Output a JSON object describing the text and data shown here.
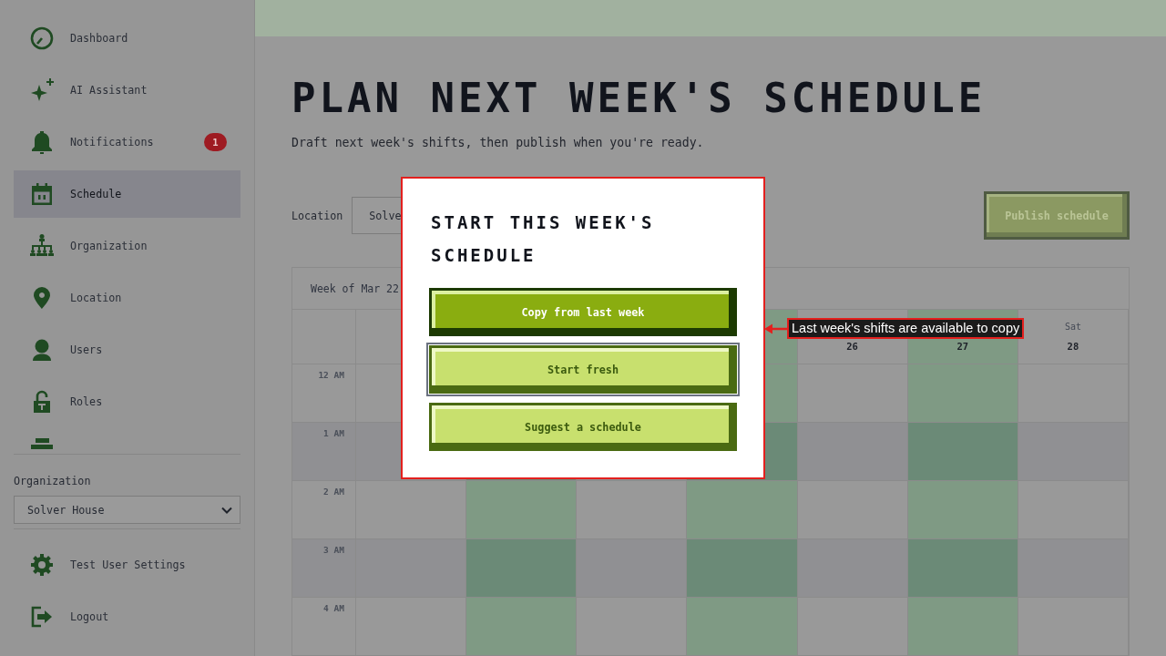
{
  "sidebar": {
    "nav_items": [
      {
        "label": "Dashboard",
        "selected": false
      },
      {
        "label": "AI Assistant",
        "selected": false
      },
      {
        "label": "Notifications",
        "selected": false,
        "badge": "1"
      },
      {
        "label": "Schedule",
        "selected": true
      },
      {
        "label": "Organization",
        "selected": false
      },
      {
        "label": "Location",
        "selected": false
      },
      {
        "label": "Users",
        "selected": false
      },
      {
        "label": "Roles",
        "selected": false
      },
      {
        "selected": false
      }
    ],
    "organization": {
      "label": "Organization",
      "value": "Solver House"
    },
    "footer_items": [
      {
        "label": "Test User Settings"
      },
      {
        "label": "Logout"
      }
    ]
  },
  "page": {
    "title": "PLAN NEXT WEEK'S SCHEDULE",
    "subtitle": "Draft next week's shifts, then publish when you're ready."
  },
  "toolbar": {
    "location_label": "Location",
    "location_value": "Solve",
    "publish_button": {
      "label": "Publish schedule",
      "disabled": true
    }
  },
  "calendar": {
    "week_label": "Week of Mar 22",
    "days": [
      {
        "highlighted": false
      },
      {
        "highlighted": true
      },
      {
        "highlighted": false
      },
      {
        "highlighted": true
      },
      {
        "highlighted": false,
        "date": "26"
      },
      {
        "highlighted": true,
        "date": "27"
      },
      {
        "highlighted": false,
        "day": "Sat",
        "date": "28"
      }
    ],
    "times": [
      "12 AM",
      "1 AM",
      "2 AM",
      "3 AM",
      "4 AM"
    ]
  },
  "dialog": {
    "title": "START THIS WEEK'S SCHEDULE",
    "buttons": [
      {
        "label": "Copy from last week",
        "kind": "primary",
        "focused": false
      },
      {
        "label": "Start fresh",
        "kind": "secondary",
        "focused": true
      },
      {
        "label": "Suggest a schedule",
        "kind": "secondary",
        "focused": false
      }
    ]
  },
  "callout": {
    "text": "Last week's shifts are available to copy"
  }
}
